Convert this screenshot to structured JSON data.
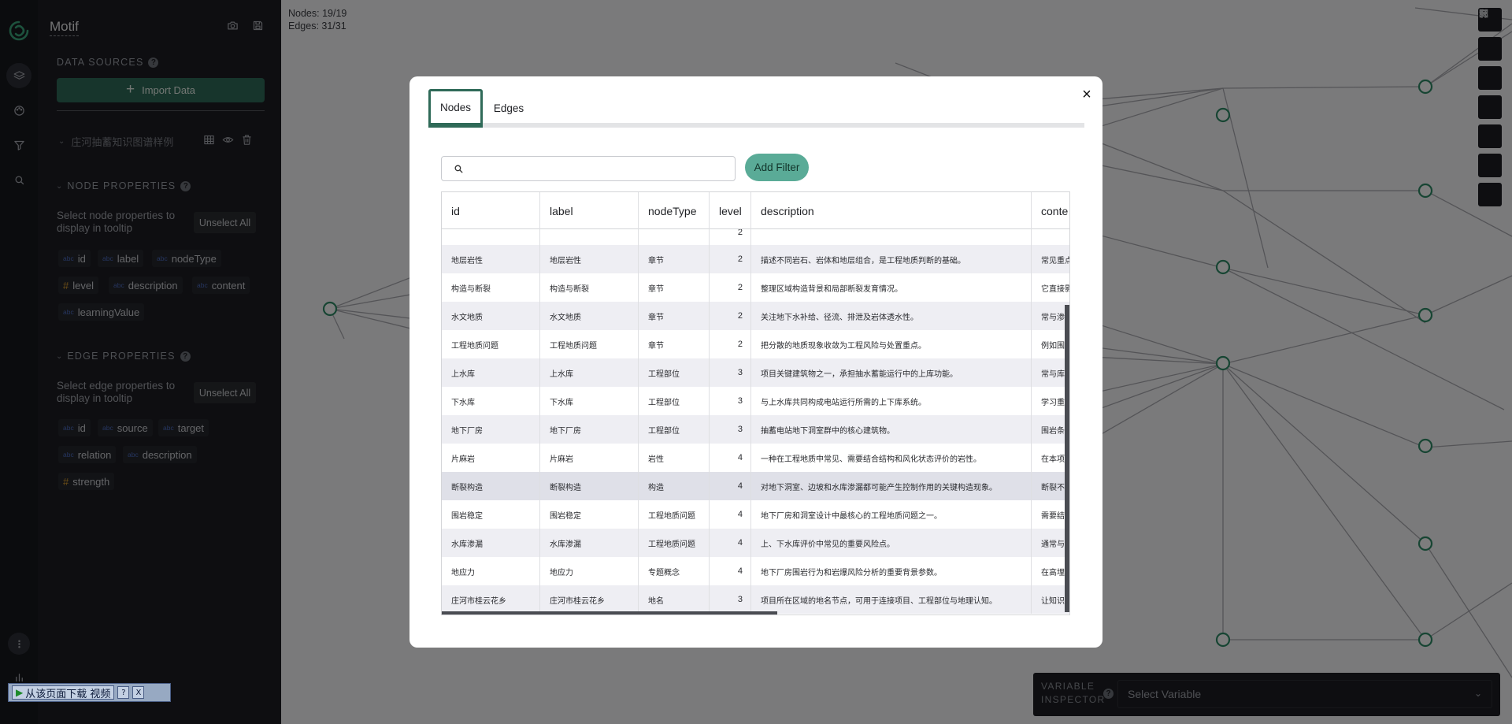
{
  "app": {
    "title": "Motif"
  },
  "rail": {
    "icons": [
      "layers-icon",
      "palette-icon",
      "filter-icon",
      "search-icon"
    ],
    "bottom_icons": [
      "more-icon",
      "chart-icon"
    ]
  },
  "panel": {
    "data_sources": {
      "title": "DATA SOURCES",
      "import_label": "Import Data",
      "dataset": "庄河抽蓄知识图谱样例"
    },
    "node_properties": {
      "title": "NODE PROPERTIES",
      "hint": "Select node properties to display in tooltip",
      "unselect_label": "Unselect All",
      "fields": [
        {
          "type": "abc",
          "name": "id"
        },
        {
          "type": "abc",
          "name": "label"
        },
        {
          "type": "abc",
          "name": "nodeType"
        },
        {
          "type": "#",
          "name": "level"
        },
        {
          "type": "abc",
          "name": "description"
        },
        {
          "type": "abc",
          "name": "content"
        },
        {
          "type": "abc",
          "name": "learningValue"
        }
      ]
    },
    "edge_properties": {
      "title": "EDGE PROPERTIES",
      "hint": "Select edge properties to display in tooltip",
      "unselect_label": "Unselect All",
      "fields": [
        {
          "type": "abc",
          "name": "id"
        },
        {
          "type": "abc",
          "name": "source"
        },
        {
          "type": "abc",
          "name": "target"
        },
        {
          "type": "abc",
          "name": "relation"
        },
        {
          "type": "abc",
          "name": "description"
        },
        {
          "type": "#",
          "name": "strength"
        }
      ]
    }
  },
  "graph": {
    "nodes_count": "Nodes: 19/19",
    "edges_count": "Edges: 31/31",
    "toolbar": [
      "list-icon",
      "fullscreen-icon",
      "undo-icon",
      "redo-icon",
      "zoom-in-icon",
      "zoom-out-icon",
      "close-icon"
    ],
    "accent": "#2f8a67"
  },
  "variable_inspector": {
    "label_1": "VARIABLE",
    "label_2": "INSPECTOR",
    "placeholder": "Select Variable"
  },
  "modal": {
    "tabs": [
      "Nodes",
      "Edges"
    ],
    "active_tab": "Nodes",
    "add_filter_label": "Add Filter",
    "columns": [
      "id",
      "label",
      "nodeType",
      "level",
      "description",
      "conte"
    ],
    "partial_level": "2",
    "rows": [
      {
        "id": "地层岩性",
        "label": "地层岩性",
        "nodeType": "章节",
        "level": "2",
        "description": "描述不同岩石、岩体和地层组合，是工程地质判断的基础。",
        "content": "常见重点"
      },
      {
        "id": "构造与断裂",
        "label": "构造与断裂",
        "nodeType": "章节",
        "level": "2",
        "description": "整理区域构造背景和局部断裂发育情况。",
        "content": "它直接影"
      },
      {
        "id": "水文地质",
        "label": "水文地质",
        "nodeType": "章节",
        "level": "2",
        "description": "关注地下水补给、径流、排泄及岩体透水性。",
        "content": "常与渗漏"
      },
      {
        "id": "工程地质问题",
        "label": "工程地质问题",
        "nodeType": "章节",
        "level": "2",
        "description": "把分散的地质现象收敛为工程风险与处置重点。",
        "content": "例如围岩"
      },
      {
        "id": "上水库",
        "label": "上水库",
        "nodeType": "工程部位",
        "level": "3",
        "description": "项目关键建筑物之一，承担抽水蓄能运行中的上库功能。",
        "content": "常与库盆"
      },
      {
        "id": "下水库",
        "label": "下水库",
        "nodeType": "工程部位",
        "level": "3",
        "description": "与上水库共同构成电站运行所需的上下库系统。",
        "content": "学习重点"
      },
      {
        "id": "地下厂房",
        "label": "地下厂房",
        "nodeType": "工程部位",
        "level": "3",
        "description": "抽蓄电站地下洞室群中的核心建筑物。",
        "content": "围岩条件"
      },
      {
        "id": "片麻岩",
        "label": "片麻岩",
        "nodeType": "岩性",
        "level": "4",
        "description": "一种在工程地质中常见、需要结合结构和风化状态评价的岩性。",
        "content": "在本项目"
      },
      {
        "id": "断裂构造",
        "label": "断裂构造",
        "nodeType": "构造",
        "level": "4",
        "description": "对地下洞室、边坡和水库渗漏都可能产生控制作用的关键构造现象。",
        "content": "断裂不仅"
      },
      {
        "id": "围岩稳定",
        "label": "围岩稳定",
        "nodeType": "工程地质问题",
        "level": "4",
        "description": "地下厂房和洞室设计中最核心的工程地质问题之一。",
        "content": "需要结合"
      },
      {
        "id": "水库渗漏",
        "label": "水库渗漏",
        "nodeType": "工程地质问题",
        "level": "4",
        "description": "上、下水库评价中常见的重要风险点。",
        "content": "通常与断"
      },
      {
        "id": "地应力",
        "label": "地应力",
        "nodeType": "专题概念",
        "level": "4",
        "description": "地下厂房围岩行为和岩爆风险分析的重要背景参数。",
        "content": "在高埋深"
      },
      {
        "id": "庄河市桂云花乡",
        "label": "庄河市桂云花乡",
        "nodeType": "地名",
        "level": "3",
        "description": "项目所在区域的地名节点，可用于连接项目、工程部位与地理认知。",
        "content": "让知识图"
      }
    ]
  },
  "download_bar": {
    "label": "从该页面下载 视频",
    "help": "?",
    "close": "X"
  }
}
